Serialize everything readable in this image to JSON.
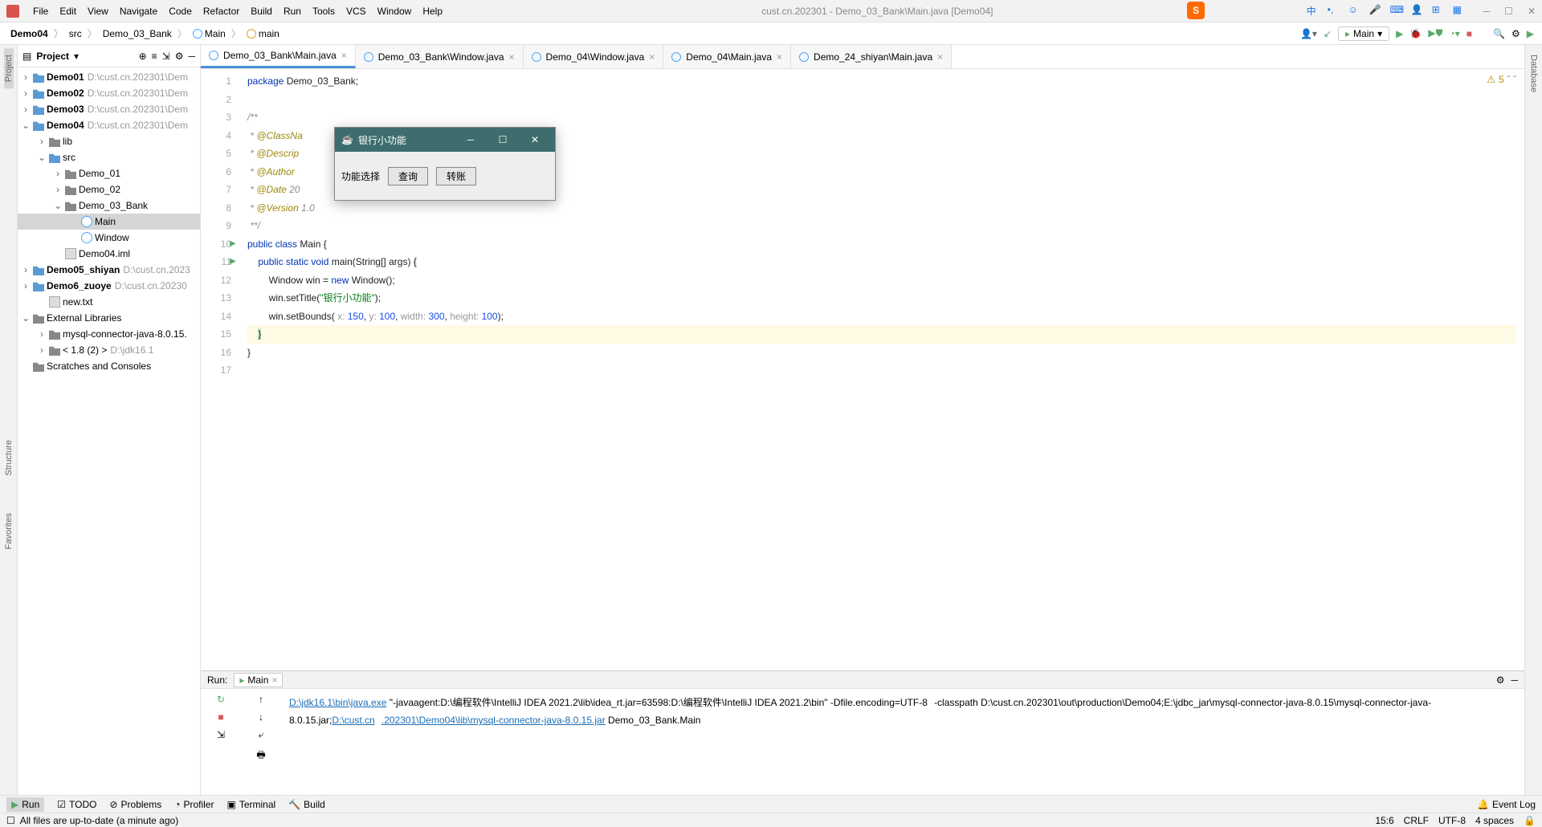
{
  "window_title": "cust.cn.202301 - Demo_03_Bank\\Main.java [Demo04]",
  "menu": [
    "File",
    "Edit",
    "View",
    "Navigate",
    "Code",
    "Refactor",
    "Build",
    "Run",
    "Tools",
    "VCS",
    "Window",
    "Help"
  ],
  "breadcrumb": [
    "Demo04",
    "src",
    "Demo_03_Bank",
    "Main",
    "main"
  ],
  "run_config": "Main",
  "project_label": "Project",
  "tree": {
    "d1": {
      "name": "Demo01",
      "path": "D:\\cust.cn.202301\\Dem"
    },
    "d2": {
      "name": "Demo02",
      "path": "D:\\cust.cn.202301\\Dem"
    },
    "d3": {
      "name": "Demo03",
      "path": "D:\\cust.cn.202301\\Dem"
    },
    "d4": {
      "name": "Demo04",
      "path": "D:\\cust.cn.202301\\Dem"
    },
    "lib": "lib",
    "src": "src",
    "p1": "Demo_01",
    "p2": "Demo_02",
    "p3": "Demo_03_Bank",
    "main": "Main",
    "window": "Window",
    "iml": "Demo04.iml",
    "d5": {
      "name": "Demo05_shiyan",
      "path": "D:\\cust.cn.2023"
    },
    "d6": {
      "name": "Demo6_zuoye",
      "path": "D:\\cust.cn.20230"
    },
    "newtxt": "new.txt",
    "ext": "External Libraries",
    "mysql": "mysql-connector-java-8.0.15.",
    "jdk": "< 1.8 (2) >",
    "jdkpath": "D:\\jdk16.1",
    "scratch": "Scratches and Consoles"
  },
  "tabs": [
    "Demo_03_Bank\\Main.java",
    "Demo_03_Bank\\Window.java",
    "Demo_04\\Window.java",
    "Demo_04\\Main.java",
    "Demo_24_shiyan\\Main.java"
  ],
  "code": {
    "l1": "package Demo_03_Bank;",
    "l3": "/**",
    "l4": " * @ClassNa",
    "l5": " * @Descrip",
    "l6": " * @Author",
    "l7": " * @Date 20",
    "l8": " * @Version 1.0",
    "l9": " **/",
    "l10a": "public class ",
    "l10b": "Main {",
    "l11a": "    public static void ",
    "l11b": "main",
    "l11c": "(String[] args) ",
    "l11d": "{",
    "l12a": "        Window win = ",
    "l12b": "new ",
    "l12c": "Window();",
    "l13a": "        win.setTitle(",
    "l13b": "\"银行小功能\"",
    "l13c": ");",
    "l14a": "        win.setBounds( ",
    "l14h1": "x: ",
    "l14n1": "150",
    "l14s1": ", ",
    "l14h2": "y: ",
    "l14n2": "100",
    "l14s2": ", ",
    "l14h3": "width: ",
    "l14n3": "300",
    "l14s3": ", ",
    "l14h4": "height: ",
    "l14n4": "100",
    "l14e": ");",
    "l15": "    }",
    "l16": "}"
  },
  "warn_count": "5",
  "dialog": {
    "title": "银行小功能",
    "label": "功能选择",
    "btn1": "查询",
    "btn2": "转账"
  },
  "run": {
    "tab": "Main",
    "header": "Run:",
    "javaexe": "D:\\jdk16.1\\bin\\java.exe",
    "args": " \"-javaagent:D:\\编程软件\\IntelliJ IDEA 2021.2\\lib\\idea_rt.jar=63598:D:\\编程软件\\IntelliJ IDEA 2021.2\\bin\" -Dfile.encoding=UTF-8",
    "cp": "  -classpath D:\\cust.cn.202301\\out\\production\\Demo04;E:\\jdbc_jar\\mysql-connector-java-8.0.15\\mysql-connector-java-8.0.15.jar;",
    "cplink": "D:\\cust.cn",
    "cp2": ".202301\\Demo04\\lib\\mysql-connector-java-8.0.15.jar",
    "mainclass": " Demo_03_Bank.Main"
  },
  "bottombar": {
    "run": "Run",
    "todo": "TODO",
    "problems": "Problems",
    "profiler": "Profiler",
    "terminal": "Terminal",
    "build": "Build",
    "eventlog": "Event Log"
  },
  "status": {
    "msg": "All files are up-to-date (a minute ago)",
    "pos": "15:6",
    "crlf": "CRLF",
    "enc": "UTF-8",
    "indent": "4 spaces"
  },
  "sidebar_left": [
    "Project",
    "Structure",
    "Favorites"
  ],
  "sidebar_right": "Database"
}
